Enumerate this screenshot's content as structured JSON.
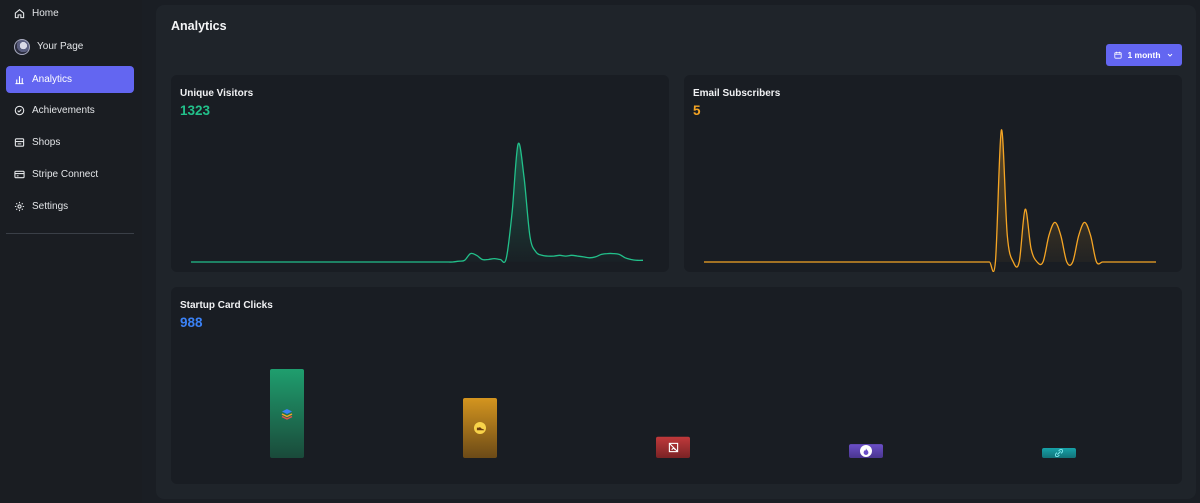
{
  "sidebar": {
    "items": [
      {
        "label": "Home",
        "icon": "home-icon"
      },
      {
        "label": "Your Page",
        "icon": "avatar"
      },
      {
        "label": "Analytics",
        "icon": "bar-chart-icon",
        "active": true
      },
      {
        "label": "Achievements",
        "icon": "check-circle-icon"
      },
      {
        "label": "Shops",
        "icon": "shop-icon"
      },
      {
        "label": "Stripe Connect",
        "icon": "credit-card-icon"
      },
      {
        "label": "Settings",
        "icon": "gear-icon"
      }
    ]
  },
  "header": {
    "title": "Analytics",
    "range_label": "1 month"
  },
  "cards": {
    "visitors": {
      "title": "Unique Visitors",
      "value": "1323",
      "color": "#22c08a"
    },
    "subscribers": {
      "title": "Email Subscribers",
      "value": "5",
      "color": "#f5a524"
    },
    "clicks": {
      "title": "Startup Card Clicks",
      "value": "988",
      "color": "#3b82f6"
    }
  },
  "chart_data": [
    {
      "type": "area",
      "series": [
        {
          "values": [
            0,
            0,
            0,
            0,
            0,
            0,
            0,
            0,
            0,
            0,
            0,
            0,
            0,
            0,
            0,
            0,
            0,
            0,
            0,
            0,
            0,
            0,
            0,
            0,
            0,
            0,
            0,
            0,
            0,
            0,
            0,
            0,
            0,
            0,
            0,
            0,
            0,
            0,
            0,
            0,
            0,
            0,
            0,
            0,
            0,
            1,
            2,
            10,
            8,
            3,
            3,
            4,
            3,
            4,
            60,
            140,
            100,
            30,
            12,
            8,
            7,
            7,
            8,
            7,
            8,
            7,
            6,
            5,
            6,
            9,
            10,
            10,
            9,
            5,
            3,
            2,
            2
          ]
        }
      ],
      "color": "#22c08a"
    },
    {
      "type": "area",
      "series": [
        {
          "values": [
            0,
            0,
            0,
            0,
            0,
            0,
            0,
            0,
            0,
            0,
            0,
            0,
            0,
            0,
            0,
            0,
            0,
            0,
            0,
            0,
            0,
            0,
            0,
            0,
            0,
            0,
            0,
            0,
            0,
            0,
            0,
            0,
            0,
            0,
            0,
            0,
            0,
            0,
            0,
            0,
            0,
            0,
            0,
            0,
            0,
            0,
            0,
            0,
            0,
            0,
            5,
            1,
            0,
            0,
            2,
            0.5,
            0,
            0,
            1,
            1.5,
            1,
            0,
            0,
            1,
            1.5,
            1,
            0,
            0,
            0,
            0,
            0,
            0,
            0,
            0,
            0,
            0,
            0
          ]
        }
      ],
      "color": "#f5a524"
    },
    {
      "type": "bar",
      "values": [
        230,
        155,
        55,
        36,
        24
      ],
      "colors": [
        [
          "#1f9e6e",
          "#1a4a3a"
        ],
        [
          "#d4951f",
          "#6b4a17"
        ],
        [
          "#c0393b",
          "#7a2325"
        ],
        [
          "#6b4fc8",
          "#4a3690"
        ],
        [
          "#17a2a8",
          "#127278"
        ]
      ],
      "icons": [
        "layers-icon",
        "shoe-icon",
        "no-image-icon",
        "flame-icon",
        "link-icon"
      ]
    }
  ]
}
